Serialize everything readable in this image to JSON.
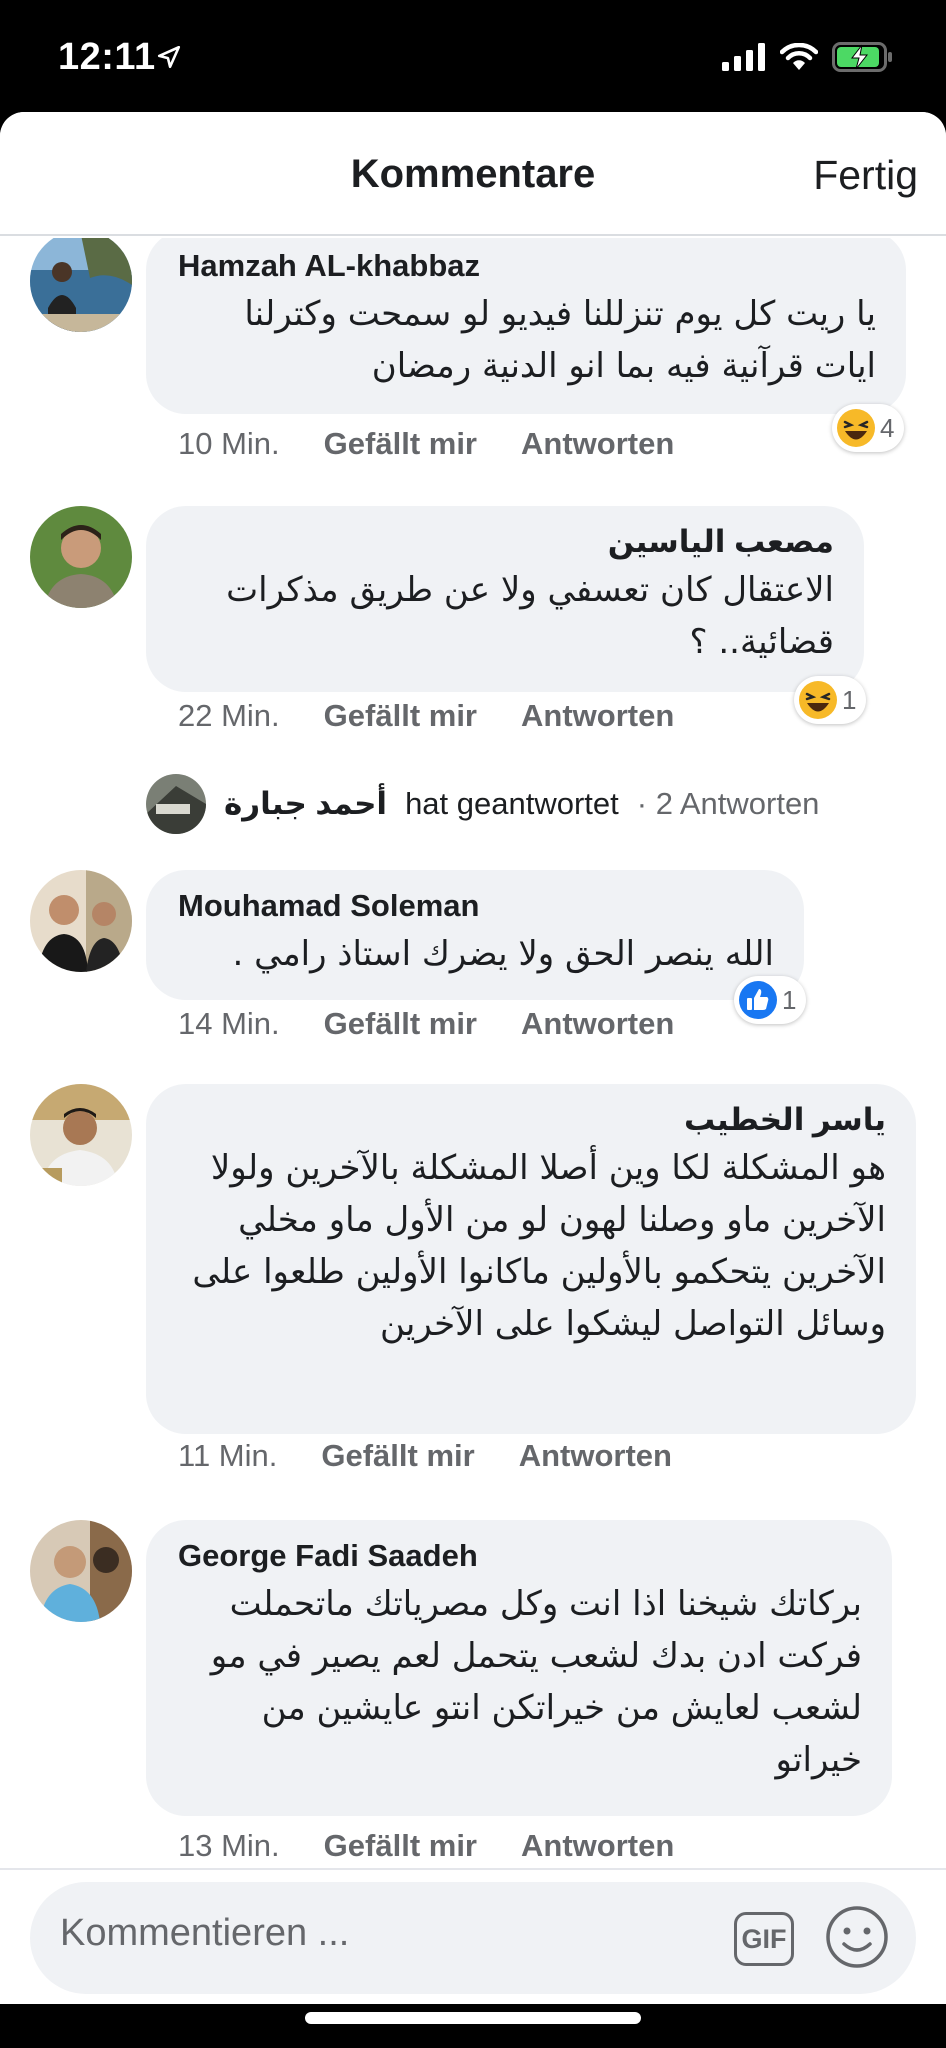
{
  "status_bar": {
    "time": "12:11"
  },
  "header": {
    "title": "Kommentare",
    "done_label": "Fertig"
  },
  "comments": [
    {
      "author": "Hamzah AL-khabbaz",
      "text": "يا ريت كل يوم تنزللنا فيديو لو سمحت وكترلنا ايات قرآنية فيه بما انو الدنية رمضان",
      "time": "10 Min.",
      "like_label": "Gefällt mir",
      "reply_label": "Antworten",
      "reaction": {
        "icon": "haha-reaction-icon",
        "count": "4"
      }
    },
    {
      "author": "مصعب الياسين",
      "text": "الاعتقال كان تعسفي ولا عن طريق مذكرات قضائية.. ؟",
      "time": "22 Min.",
      "like_label": "Gefällt mir",
      "reply_label": "Antworten",
      "reaction": {
        "icon": "haha-reaction-icon",
        "count": "1"
      }
    },
    {
      "author": "Mouhamad Soleman",
      "text": "الله ينصر الحق  ولا يضرك استاذ رامي .",
      "time": "14 Min.",
      "like_label": "Gefällt mir",
      "reply_label": "Antworten",
      "reaction": {
        "icon": "like-reaction-icon",
        "count": "1"
      }
    },
    {
      "author": "ياسر الخطيب",
      "text": "هو المشكلة لكا وين أصلا المشكلة بالآخرين ولولا الآخرين ماو وصلنا لهون لو من الأول ماو مخلي الآخرين يتحكمو بالأولين  ماكانوا الأولين طلعوا على وسائل التواصل ليشكوا على الآخرين",
      "time": "11 Min.",
      "like_label": "Gefällt mir",
      "reply_label": "Antworten"
    },
    {
      "author": "George Fadi Saadeh",
      "text": "بركاتك شيخنا اذا انت وكل مصرياتك ماتحملت فركت ادن بدك لشعب يتحمل لعم يصير في مو لشعب لعايش من خيراتكن انتو عايشين من خيراتو",
      "time": "13 Min.",
      "like_label": "Gefällt mir",
      "reply_label": "Antworten"
    }
  ],
  "replies": {
    "name": "أحمد جبارة",
    "text": "hat geantwortet",
    "count": "· 2 Antworten"
  },
  "composer": {
    "placeholder": "Kommentieren ...",
    "gif_label": "GIF"
  },
  "colors": {
    "bubble": "#f0f2f5",
    "meta": "#65676b",
    "like_blue": "#1877f2",
    "haha_yellow": "#f7b928"
  }
}
